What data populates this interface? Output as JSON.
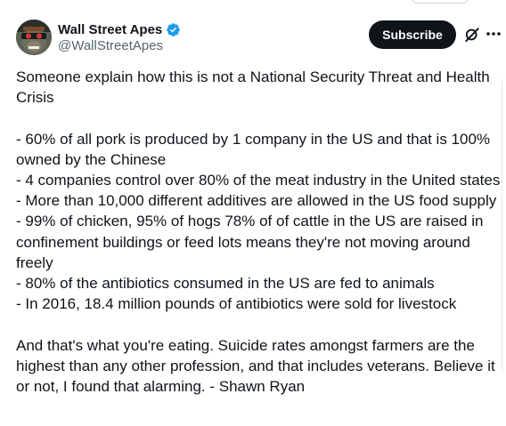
{
  "tweet": {
    "author": {
      "display_name": "Wall Street Apes",
      "handle": "@WallStreetApes",
      "verified": true
    },
    "actions": {
      "subscribe_label": "Subscribe",
      "grok_icon": "grok-icon",
      "more_icon": "more-options-icon"
    },
    "intro": "Someone explain how this is not a National Security Threat and Health Crisis",
    "bullets": [
      "- 60% of all pork is produced by 1 company in the US and that is 100% owned by the Chinese",
      "- 4 companies control over 80% of the meat industry in the United states",
      "- More than 10,000 different additives are allowed in the US food supply",
      "- 99% of chicken, 95% of hogs 78% of of cattle in the US are raised in confinement buildings or feed lots means they're not moving around freely",
      "- 80% of the antibiotics consumed in the US are fed to animals",
      "- In 2016, 18.4 million pounds of antibiotics were sold for livestock"
    ],
    "closing": "And that's what you're eating. Suicide rates amongst farmers are the highest than any other profession, and that includes veterans. Believe it or not, I found that alarming. - Shawn Ryan"
  },
  "colors": {
    "text": "#0f1419",
    "secondary_text": "#536471",
    "verified_blue": "#1d9bf0",
    "button_bg": "#0f1419"
  }
}
